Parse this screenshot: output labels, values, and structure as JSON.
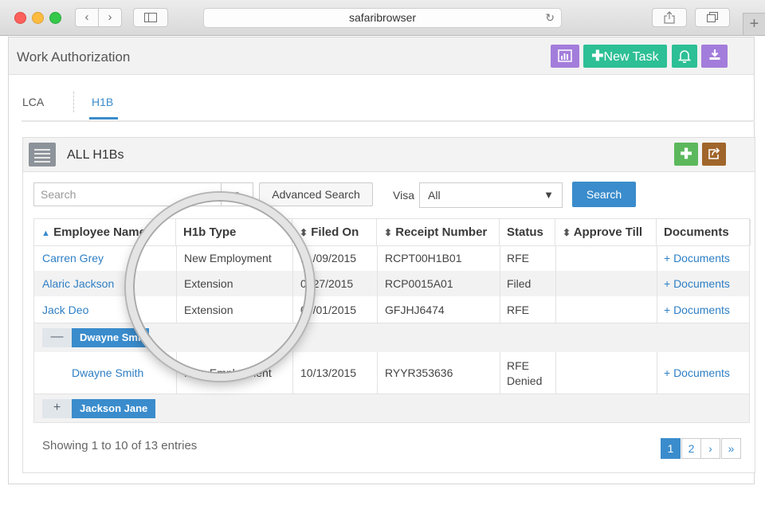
{
  "browser": {
    "url": "safaribrowser",
    "back_icon": "chevron-left",
    "forward_icon": "chevron-right",
    "sidebar_icon": "sidebar",
    "reload_icon": "reload",
    "share_icon": "share",
    "tabs_icon": "tabs",
    "newtab_icon": "plus"
  },
  "header": {
    "title": "Work Authorization",
    "new_task_label": "New Task"
  },
  "tabs": [
    {
      "label": "LCA",
      "active": false
    },
    {
      "label": "H1B",
      "active": true
    }
  ],
  "panel": {
    "title": "ALL H1Bs"
  },
  "filters": {
    "search_placeholder": "Search",
    "advanced_label": "Advanced Search",
    "visa_label": "Visa",
    "visa_value": "All",
    "search_button": "Search"
  },
  "table": {
    "headers": [
      "Employee Name",
      "H1b Type",
      "Filed On",
      "Receipt Number",
      "Status",
      "Approve Till",
      "Documents"
    ],
    "rows": [
      {
        "name": "Carren Grey",
        "type": "New Employment",
        "filed": "1  /09/2015",
        "receipt": "RCPT00H1B01",
        "status": "RFE",
        "approve": "",
        "docs": "+ Documents"
      },
      {
        "name": "Alaric Jackson",
        "type": "Extension",
        "filed": "0  27/2015",
        "receipt": "RCP0015A01",
        "status": "Filed",
        "approve": "",
        "docs": "+ Documents"
      },
      {
        "name": "Jack Deo",
        "type": "Extension",
        "filed": "0  /01/2015",
        "receipt": "GFJHJ6474",
        "status": "RFE",
        "approve": "",
        "docs": "+ Documents"
      }
    ],
    "group_expanded": {
      "toggle": "—",
      "label": "Dwayne Smi",
      "row": {
        "name": "Dwayne Smith",
        "type": "New Employment",
        "filed": "10/13/2015",
        "receipt": "RYYR353636",
        "status_line1": "RFE",
        "status_line2": "Denied",
        "approve": "",
        "docs": "+ Documents"
      }
    },
    "group_collapsed": {
      "toggle": "+",
      "label": "Jackson Jane"
    }
  },
  "footer": {
    "info": "Showing 1 to 10 of 13 entries",
    "pages": [
      "1",
      "2",
      "›",
      "»"
    ],
    "active_page": "1"
  },
  "colors": {
    "primary": "#3a8ccc",
    "purple": "#a37ddb",
    "teal": "#2dbf95",
    "green": "#5cb85c",
    "brown": "#a0652a"
  }
}
